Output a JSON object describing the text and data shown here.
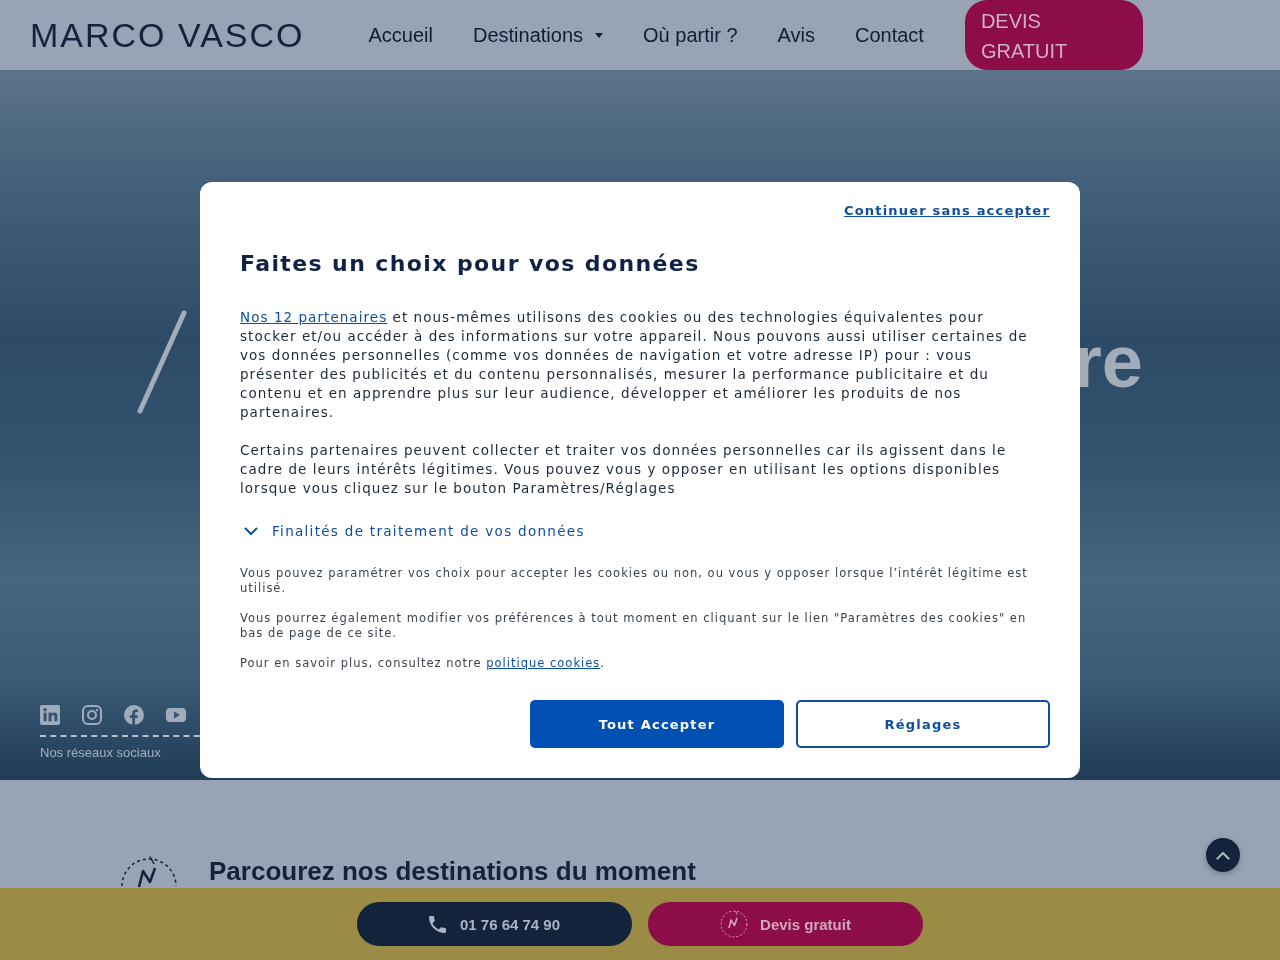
{
  "header": {
    "logo": "MARCO VASCO",
    "nav": [
      {
        "label": "Accueil",
        "dropdown": false
      },
      {
        "label": "Destinations",
        "dropdown": true
      },
      {
        "label": "Où partir ?",
        "dropdown": false
      },
      {
        "label": "Avis",
        "dropdown": false
      },
      {
        "label": "Contact",
        "dropdown": false
      }
    ],
    "cta": "DEVIS GRATUIT"
  },
  "hero": {
    "title_fragment": "re",
    "social_label": "Nos réseaux sociaux"
  },
  "consent_dialog": {
    "skip_link": "Continuer sans accepter",
    "title": "Faites un choix pour vos données",
    "intro": {
      "link": "Nos 12 partenaires",
      "text": "et nous-mêmes utilisons des cookies ou des technologies équivalentes pour stocker et/ou accéder à des informations sur votre appareil. Nous pouvons aussi utiliser certaines de vos données personnelles (comme vos données de navigation et votre adresse IP) pour : vous présenter des publicités et du contenu personnalisés, mesurer la performance publicitaire et du contenu et en apprendre plus sur leur audience, développer et améliorer les produits de nos partenaires."
    },
    "legitimate_interest": "Certains partenaires peuvent collecter et traiter vos données personnelles car ils agissent dans le cadre de leurs intérêts légitimes. Vous pouvez vous y opposer en utilisant les options disponibles lorsque vous cliquez sur le bouton Paramètres/Réglages",
    "purposes": {
      "label": "Finalités de traitement de vos données",
      "expanded": false
    },
    "notes": [
      "Vous pouvez paramétrer vos choix pour accepter les cookies ou non, ou vous y opposer lorsque l’intérêt légitime est utilisé.",
      "Vous pourrez également modifier vos préférences à tout moment en cliquant sur le lien \"Paramètres des cookies\" en bas de page de ce site."
    ],
    "more_info": {
      "text": "Pour en savoir plus, consultez notre",
      "link": "politique cookies",
      "end": "."
    },
    "buttons": [
      {
        "label": "Tout Accepter",
        "kind": "primary"
      },
      {
        "label": "Réglages",
        "kind": "secondary"
      }
    ]
  },
  "destinations_section": {
    "title": "Parcourez nos destinations du moment"
  },
  "sticky_bar": {
    "phone": "01 76 64 74 90",
    "quote_button": "Devis gratuit"
  }
}
